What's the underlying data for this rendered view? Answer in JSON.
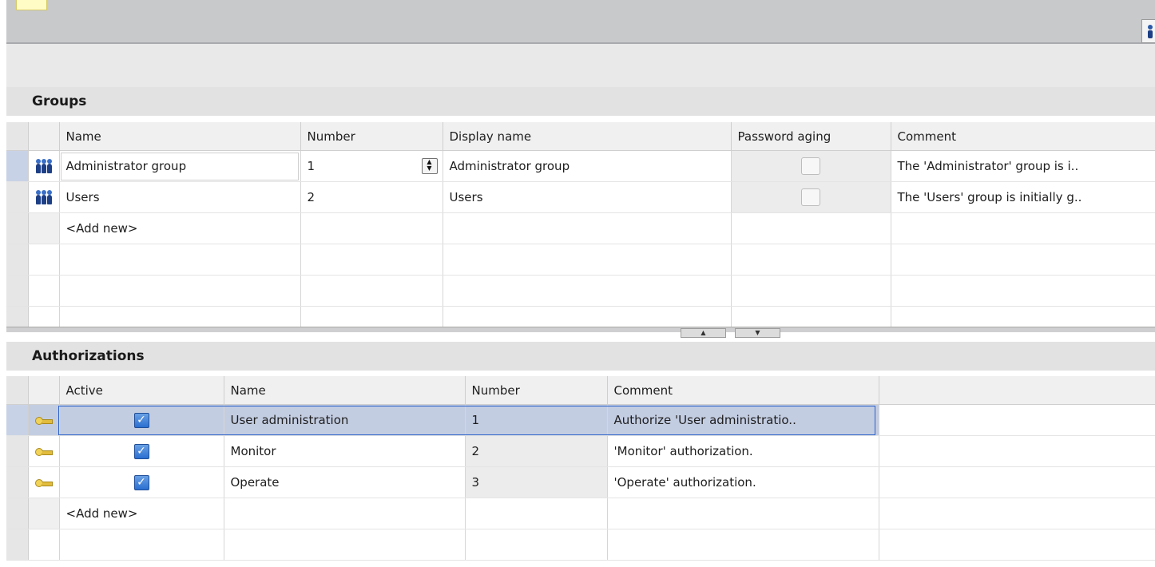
{
  "toolbar": {
    "tab_icon": "note-tab",
    "right_icon": "user-icon"
  },
  "groups": {
    "title": "Groups",
    "columns": [
      "Name",
      "Number",
      "Display name",
      "Password aging",
      "Comment"
    ],
    "rows": [
      {
        "name": "Administrator group",
        "number": "1",
        "display_name": "Administrator group",
        "password_aging": false,
        "comment": "The 'Administrator' group is i.."
      },
      {
        "name": "Users",
        "number": "2",
        "display_name": "Users",
        "password_aging": false,
        "comment": "The 'Users' group is initially g.."
      }
    ],
    "add_new": "<Add new>"
  },
  "authorizations": {
    "title": "Authorizations",
    "columns": [
      "Active",
      "Name",
      "Number",
      "Comment"
    ],
    "rows": [
      {
        "active": true,
        "name": "User administration",
        "number": "1",
        "comment": "Authorize 'User administratio.."
      },
      {
        "active": true,
        "name": "Monitor",
        "number": "2",
        "comment": "'Monitor' authorization."
      },
      {
        "active": true,
        "name": "Operate",
        "number": "3",
        "comment": "'Operate' authorization."
      }
    ],
    "add_new": "<Add new>"
  },
  "splitter": {
    "up_icon": "arrow-up-icon",
    "down_icon": "arrow-down-icon"
  }
}
